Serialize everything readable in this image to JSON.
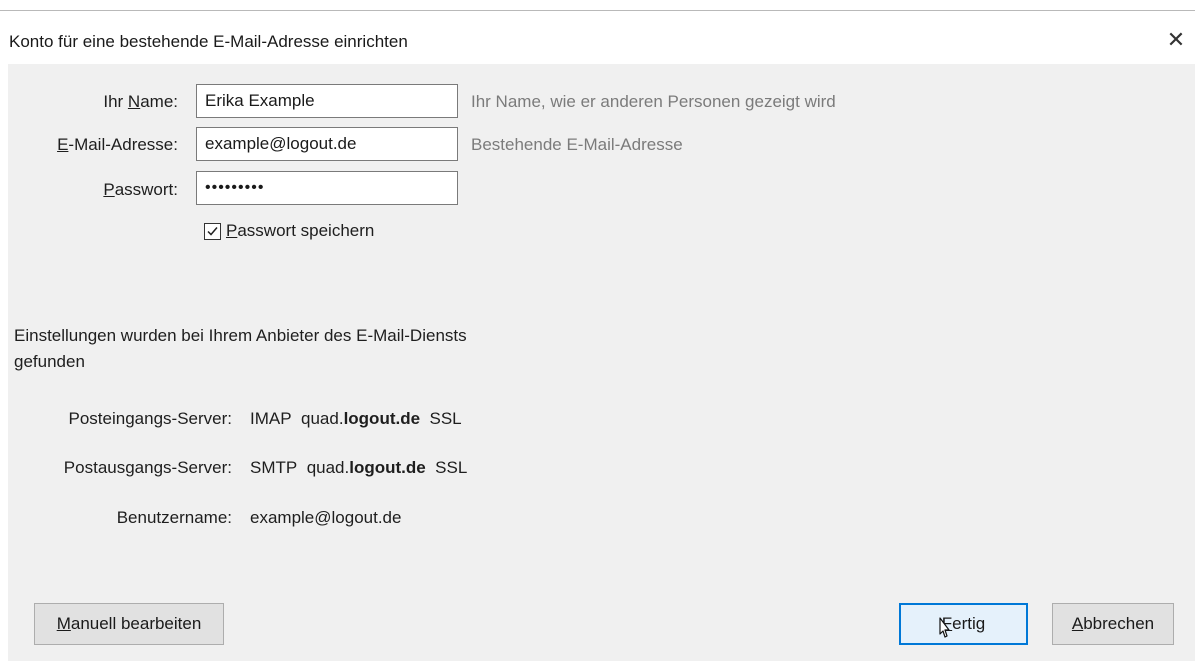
{
  "dialog": {
    "title": "Konto für eine bestehende E-Mail-Adresse einrichten",
    "close_glyph": "✕"
  },
  "form": {
    "name_label_pre": "Ihr ",
    "name_label_key": "N",
    "name_label_post": "ame:",
    "name_value": "Erika Example",
    "name_hint": "Ihr Name, wie er anderen Personen gezeigt wird",
    "email_label_key": "E",
    "email_label_post": "-Mail-Adresse:",
    "email_value": "example@logout.de",
    "email_hint": "Bestehende E-Mail-Adresse",
    "password_label_key": "P",
    "password_label_post": "asswort:",
    "password_value": "•••••••••",
    "save_password_key": "P",
    "save_password_post": "asswort speichern",
    "save_password_checked": true
  },
  "settings": {
    "found_line1": "Einstellungen wurden bei Ihrem Anbieter des E-Mail-Diensts",
    "found_line2": "gefunden",
    "incoming_label": "Posteingangs-Server:",
    "incoming_protocol": "IMAP",
    "incoming_host_prefix": "quad.",
    "incoming_host_domain": "logout.de",
    "incoming_security": "SSL",
    "outgoing_label": "Postausgangs-Server:",
    "outgoing_protocol": "SMTP",
    "outgoing_host_prefix": "quad.",
    "outgoing_host_domain": "logout.de",
    "outgoing_security": "SSL",
    "username_label": "Benutzername:",
    "username_value": "example@logout.de"
  },
  "buttons": {
    "manual_key": "M",
    "manual_post": "anuell bearbeiten",
    "done_key": "F",
    "done_post": "ertig",
    "cancel_key": "A",
    "cancel_post": "bbrechen"
  },
  "colors": {
    "accent": "#0078d7",
    "hint": "#7b7b7b",
    "background": "#f0f0f0"
  },
  "icons": {
    "close": "close-icon",
    "checkbox": "checkmark-icon",
    "pointer": "mouse-cursor-icon"
  }
}
